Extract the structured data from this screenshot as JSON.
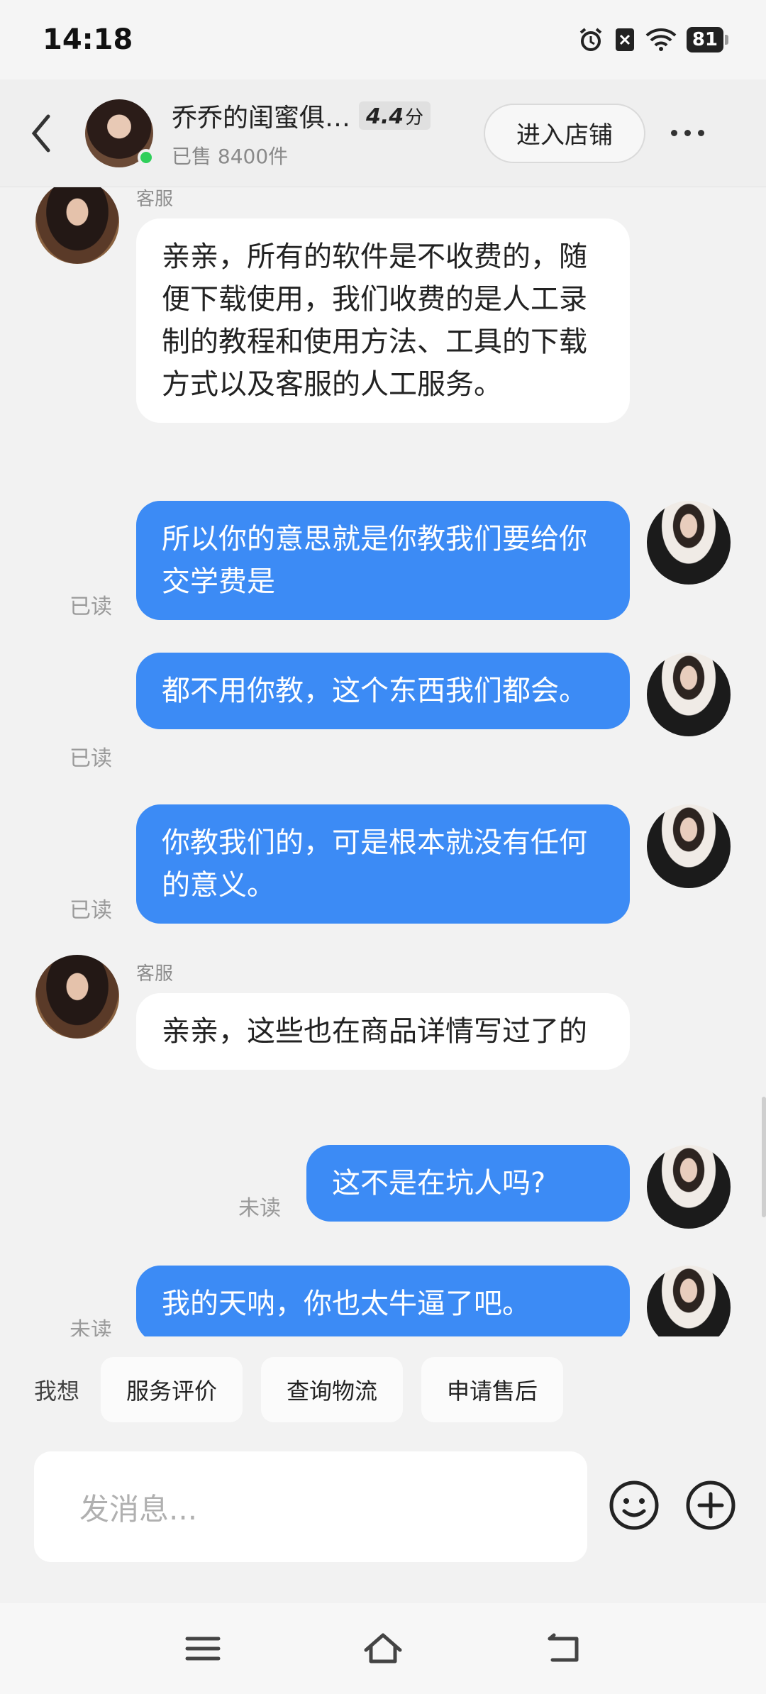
{
  "status": {
    "time": "14:18",
    "battery": "81"
  },
  "header": {
    "shop_name": "乔乔的闺蜜俱…",
    "rating": "4.4",
    "rating_unit": "分",
    "sold": "已售 8400件",
    "enter_shop": "进入店铺"
  },
  "messages": [
    {
      "from": "shop",
      "sender": "客服",
      "text": "亲亲，所有的软件是不收费的，随便下载使用，我们收费的是人工录制的教程和使用方法、工具的下载方式以及客服的人工服务。"
    },
    {
      "from": "me",
      "status": "已读",
      "text": "所以你的意思就是你教我们要给你交学费是"
    },
    {
      "from": "me",
      "status": "已读",
      "text": "都不用你教，这个东西我们都会。"
    },
    {
      "from": "me",
      "status": "已读",
      "text": "你教我们的，可是根本就没有任何的意义。"
    },
    {
      "from": "shop",
      "sender": "客服",
      "text": "亲亲，这些也在商品详情写过了的"
    },
    {
      "from": "me",
      "status": "未读",
      "text": "这不是在坑人吗?"
    },
    {
      "from": "me",
      "status": "未读",
      "text": "我的天呐，你也太牛逼了吧。"
    }
  ],
  "quick_actions": {
    "label": "我想",
    "items": [
      "服务评价",
      "查询物流",
      "申请售后"
    ]
  },
  "composer": {
    "placeholder": "发消息..."
  }
}
